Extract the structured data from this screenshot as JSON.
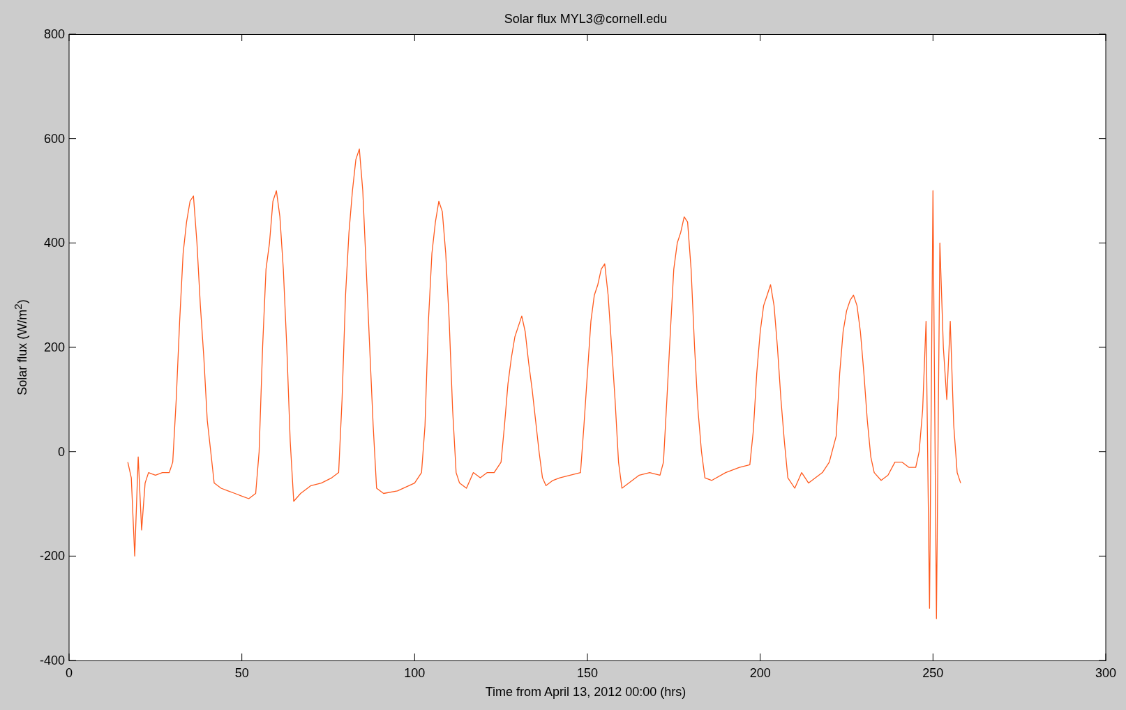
{
  "figure": {
    "chart_data": {
      "type": "line",
      "title": "Solar flux MYL3@cornell.edu",
      "xlabel": "Time from April 13, 2012 00:00 (hrs)",
      "ylabel": "Solar flux (W/m$^{2}$)",
      "xlim": [
        0,
        300
      ],
      "ylim": [
        -400,
        800
      ],
      "xticks": [
        0,
        50,
        100,
        150,
        200,
        250,
        300
      ],
      "yticks": [
        -400,
        -200,
        0,
        200,
        400,
        600,
        800
      ],
      "x": [
        17,
        18,
        19,
        20,
        21,
        22,
        23,
        25,
        27,
        29,
        30,
        31,
        32,
        33,
        34,
        35,
        36,
        37,
        38,
        39,
        40,
        41,
        42,
        44,
        46,
        48,
        50,
        52,
        54,
        55,
        56,
        57,
        58,
        59,
        60,
        61,
        62,
        63,
        64,
        65,
        67,
        70,
        73,
        76,
        78,
        79,
        80,
        81,
        82,
        83,
        84,
        85,
        86,
        87,
        88,
        89,
        91,
        95,
        100,
        102,
        103,
        104,
        105,
        106,
        107,
        108,
        109,
        110,
        111,
        112,
        113,
        115,
        117,
        119,
        121,
        123,
        125,
        126,
        127,
        128,
        129,
        130,
        131,
        132,
        133,
        134,
        135,
        136,
        137,
        138,
        140,
        142,
        145,
        148,
        149,
        150,
        151,
        152,
        153,
        154,
        155,
        156,
        157,
        158,
        159,
        160,
        162,
        165,
        168,
        171,
        172,
        173,
        174,
        175,
        176,
        177,
        178,
        179,
        180,
        181,
        182,
        183,
        184,
        186,
        190,
        194,
        197,
        198,
        199,
        200,
        201,
        202,
        203,
        204,
        205,
        206,
        207,
        208,
        210,
        212,
        214,
        216,
        218,
        220,
        222,
        223,
        224,
        225,
        226,
        227,
        228,
        229,
        230,
        231,
        232,
        233,
        235,
        237,
        239,
        241,
        243,
        245,
        246,
        247,
        248,
        249,
        250,
        251,
        252,
        253,
        254,
        255,
        256,
        257,
        258
      ],
      "series": [
        {
          "color": "#ff5a1e",
          "values": [
            -20,
            -50,
            -200,
            -10,
            -150,
            -60,
            -40,
            -45,
            -40,
            -40,
            -20,
            100,
            250,
            380,
            440,
            480,
            490,
            400,
            280,
            180,
            60,
            0,
            -60,
            -70,
            -75,
            -80,
            -85,
            -90,
            -80,
            0,
            200,
            350,
            400,
            480,
            500,
            450,
            350,
            200,
            20,
            -95,
            -80,
            -65,
            -60,
            -50,
            -40,
            100,
            300,
            420,
            500,
            560,
            580,
            500,
            350,
            200,
            50,
            -70,
            -80,
            -75,
            -60,
            -40,
            50,
            250,
            380,
            440,
            480,
            460,
            380,
            250,
            80,
            -40,
            -60,
            -70,
            -40,
            -50,
            -40,
            -40,
            -20,
            50,
            130,
            180,
            220,
            240,
            260,
            230,
            170,
            120,
            60,
            0,
            -50,
            -65,
            -55,
            -50,
            -45,
            -40,
            50,
            150,
            250,
            300,
            320,
            350,
            360,
            300,
            200,
            100,
            -20,
            -70,
            -60,
            -45,
            -40,
            -45,
            -20,
            100,
            230,
            350,
            400,
            420,
            450,
            440,
            350,
            200,
            80,
            0,
            -50,
            -55,
            -40,
            -30,
            -25,
            40,
            150,
            230,
            280,
            300,
            320,
            280,
            200,
            100,
            20,
            -50,
            -70,
            -40,
            -60,
            -50,
            -40,
            -20,
            30,
            150,
            230,
            270,
            290,
            300,
            280,
            230,
            150,
            60,
            -10,
            -40,
            -55,
            -45,
            -20,
            -20,
            -30,
            -30,
            0,
            80,
            250,
            -300,
            500,
            -320,
            400,
            200,
            100,
            250,
            50,
            -40,
            -60
          ]
        }
      ]
    }
  }
}
